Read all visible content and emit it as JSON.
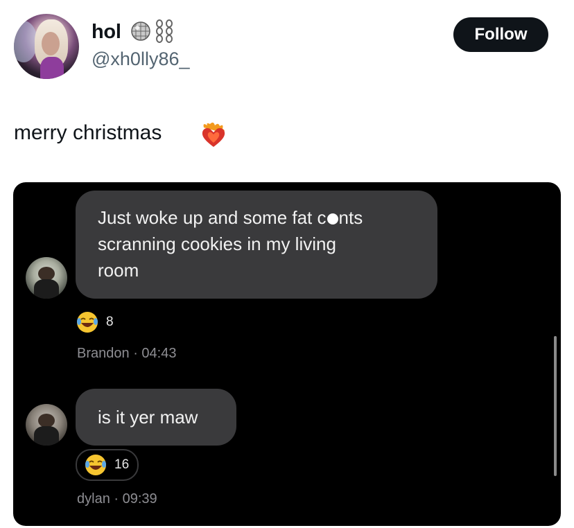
{
  "profile": {
    "display_name": "hol",
    "handle": "@xh0lly86_"
  },
  "follow_label": "Follow",
  "tweet": {
    "text": "merry christmas"
  },
  "embedded": {
    "message1": {
      "line1_before": "Just woke up and some fat c",
      "line1_after": "nts",
      "line2": "scranning cookies in my living",
      "line3": "room",
      "reaction_count": "8",
      "sender": "Brandon",
      "time": "· 04:43"
    },
    "message2": {
      "text": "is it yer maw",
      "reaction_count": "16",
      "sender": "dylan",
      "time": "· 09:39"
    }
  },
  "colors": {
    "follow_bg": "#0f1419",
    "bubble": "#3a3a3c",
    "meta": "#8e8e93",
    "handle": "#536471"
  },
  "icons": [
    "disco-ball-icon",
    "chains-icon",
    "heart-on-fire-icon",
    "laughing-emoji-icon"
  ]
}
